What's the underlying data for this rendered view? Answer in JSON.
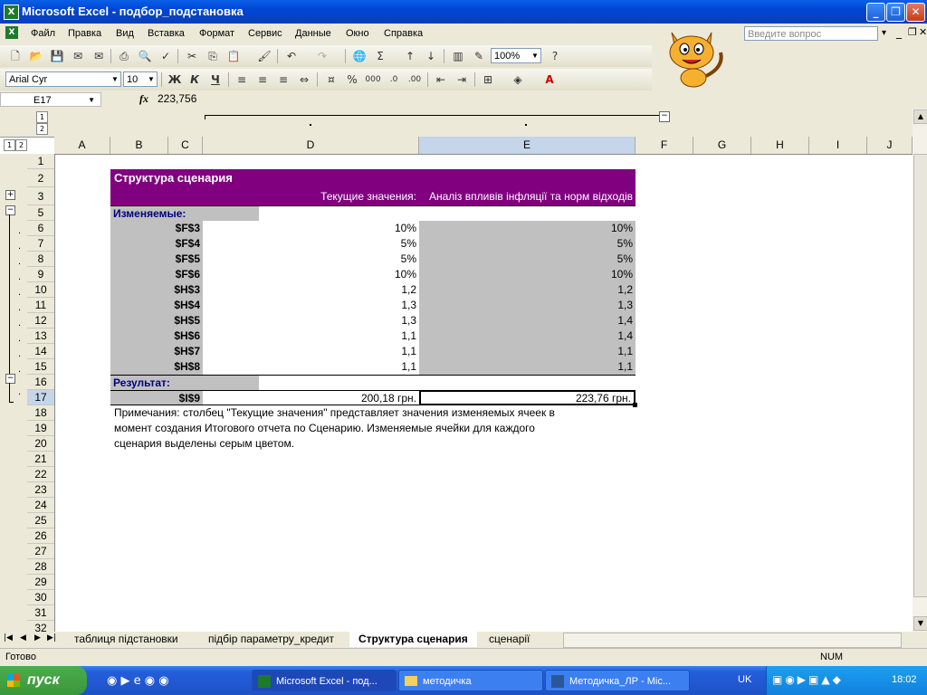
{
  "window": {
    "title": "Microsoft Excel - подбор_подстановка",
    "app_icon": "excel-icon"
  },
  "menu": {
    "items": [
      "Файл",
      "Правка",
      "Вид",
      "Вставка",
      "Формат",
      "Сервис",
      "Данные",
      "Окно",
      "Справка"
    ],
    "help_placeholder": "Введите вопрос"
  },
  "toolbar": {
    "zoom": "100%",
    "font_name": "Arial Cyr",
    "font_size": "10",
    "bold": "Ж",
    "italic": "К",
    "underline": "Ч"
  },
  "formula_bar": {
    "name_box": "E17",
    "fx": "fx",
    "formula": "223,756"
  },
  "outline": {
    "levels": [
      "1",
      "2"
    ]
  },
  "columns": [
    "A",
    "B",
    "C",
    "D",
    "E",
    "F",
    "G",
    "H",
    "I",
    "J"
  ],
  "rows": [
    "1",
    "2",
    "3",
    "5",
    "6",
    "7",
    "8",
    "9",
    "10",
    "11",
    "12",
    "13",
    "14",
    "15",
    "16",
    "17",
    "18",
    "19",
    "20",
    "21",
    "22",
    "23",
    "24",
    "25",
    "26",
    "27",
    "28",
    "29",
    "30",
    "31",
    "32"
  ],
  "report": {
    "title": "Структура сценария",
    "col_current": "Текущие значения:",
    "col_scenario": "Аналіз впливів інфляції та норм відходів",
    "changing_label": "Изменяемые:",
    "changing": [
      {
        "cell": "$F$3",
        "current": "10%",
        "scenario": "10%"
      },
      {
        "cell": "$F$4",
        "current": "5%",
        "scenario": "5%"
      },
      {
        "cell": "$F$5",
        "current": "5%",
        "scenario": "5%"
      },
      {
        "cell": "$F$6",
        "current": "10%",
        "scenario": "10%"
      },
      {
        "cell": "$H$3",
        "current": "1,2",
        "scenario": "1,2"
      },
      {
        "cell": "$H$4",
        "current": "1,3",
        "scenario": "1,3"
      },
      {
        "cell": "$H$5",
        "current": "1,3",
        "scenario": "1,4"
      },
      {
        "cell": "$H$6",
        "current": "1,1",
        "scenario": "1,4"
      },
      {
        "cell": "$H$7",
        "current": "1,1",
        "scenario": "1,1"
      },
      {
        "cell": "$H$8",
        "current": "1,1",
        "scenario": "1,1"
      }
    ],
    "result_label": "Результат:",
    "result": {
      "cell": "$I$9",
      "current": "200,18 грн.",
      "scenario": "223,76 грн."
    },
    "note_lines": [
      "Примечания: столбец \"Текущие значения\" представляет значения изменяемых ячеек в",
      "момент создания Итогового отчета по Сценарию. Изменяемые ячейки для каждого",
      "сценария выделены серым цветом."
    ]
  },
  "sheet_tabs": [
    "таблиця підстановки",
    "підбір параметру_кредит",
    "Структура сценария",
    "сценарії"
  ],
  "active_tab": "Структура сценария",
  "status": {
    "left": "Готово",
    "num": "NUM"
  },
  "taskbar": {
    "start": "пуск",
    "tasks": [
      "Microsoft Excel - под...",
      "методичка",
      "Методичка_ЛР - Mic..."
    ],
    "lang": "UK",
    "clock": "18:02"
  },
  "colors": {
    "purple": "#800080",
    "gray": "#c0c0c0",
    "selection": "#c5d5ea"
  }
}
